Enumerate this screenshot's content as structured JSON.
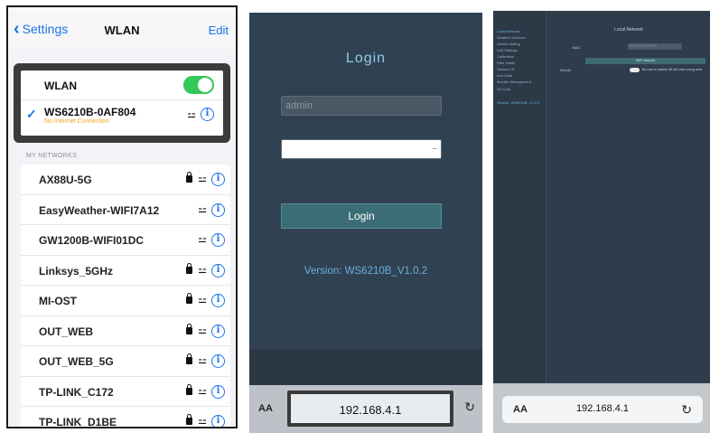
{
  "wifi_settings": {
    "nav": {
      "back_label": "Settings",
      "title": "WLAN",
      "edit_label": "Edit"
    },
    "wlan_label": "WLAN",
    "wlan_enabled": true,
    "connected": {
      "ssid": "WS6210B-0AF804",
      "status": "No Internet Connection"
    },
    "section_header": "MY NETWORKS",
    "networks": [
      {
        "name": "AX88U-5G",
        "locked": true
      },
      {
        "name": "EasyWeather-WIFI7A12",
        "locked": false
      },
      {
        "name": "GW1200B-WIFI01DC",
        "locked": false
      },
      {
        "name": "Linksys_5GHz",
        "locked": true
      },
      {
        "name": "MI-OST",
        "locked": true
      },
      {
        "name": "OUT_WEB",
        "locked": true
      },
      {
        "name": "OUT_WEB_5G",
        "locked": true
      },
      {
        "name": "TP-LINK_C172",
        "locked": true
      },
      {
        "name": "TP-LINK_D1BE",
        "locked": true
      }
    ],
    "colors": {
      "accent": "#1a73e8",
      "toggle_on": "#34c759",
      "warning": "#f5a623"
    }
  },
  "login": {
    "title": "Login",
    "username_value": "admin",
    "button_label": "Login",
    "version": "Version: WS6210B_V1.0.2",
    "browser": {
      "text_size_label": "AA",
      "url": "192.168.4.1"
    }
  },
  "local_network": {
    "sidebar": [
      "Local Network",
      "Weather Services",
      "Device Setting",
      "Unit Settings",
      "Calibration",
      "Rain Totals",
      "Sensors ID",
      "Live Data",
      "Monitor Management",
      "SD Card",
      "Version: WS6210B_V1.0.2"
    ],
    "active_index": 0,
    "title": "Local Network",
    "mac_label": "MAC",
    "mac_value": "80:0A:C2:0A:F8:04",
    "wifi_button": "WiFi Network",
    "wlan_label": "WLAN",
    "wlan_description": "Be sure to disable WLAN when using solar",
    "browser": {
      "text_size_label": "AA",
      "url": "192.168.4.1"
    }
  }
}
